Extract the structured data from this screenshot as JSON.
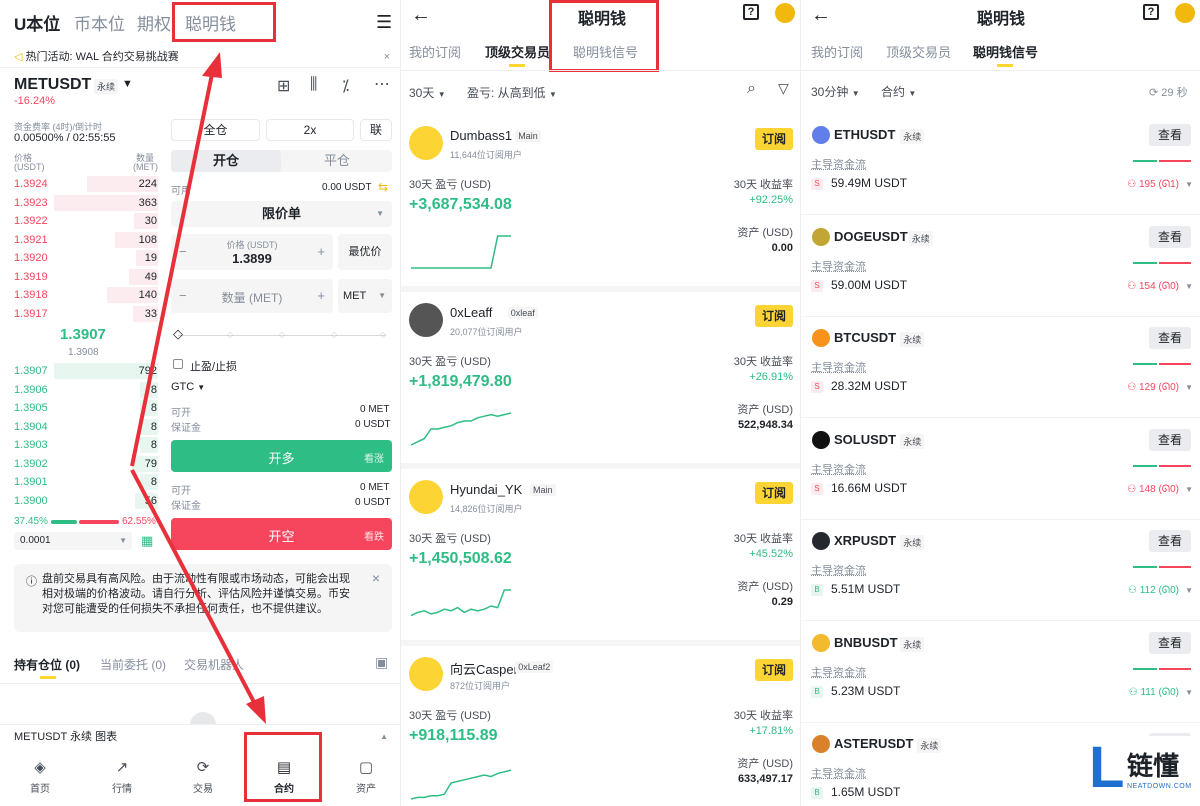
{
  "panel1": {
    "tabs": [
      "U本位",
      "币本位",
      "期权",
      "聪明钱"
    ],
    "menu_icon": "hamburger-icon",
    "banner": "热门活动: WAL 合约交易挑战赛",
    "symbol": "METUSDT",
    "perp": "永续",
    "change": "-16.24%",
    "funding_label": "资金费率 (4时)/倒计时",
    "funding_value": "0.00500% / 02:55:55",
    "ob_price_label": "价格",
    "ob_price_unit": "(USDT)",
    "ob_qty_label": "数量",
    "ob_qty_unit": "(MET)",
    "asks": [
      {
        "p": "1.3924",
        "q": "224"
      },
      {
        "p": "1.3923",
        "q": "363"
      },
      {
        "p": "1.3922",
        "q": "30"
      },
      {
        "p": "1.3921",
        "q": "108"
      },
      {
        "p": "1.3920",
        "q": "19"
      },
      {
        "p": "1.3919",
        "q": "49"
      },
      {
        "p": "1.3918",
        "q": "140"
      },
      {
        "p": "1.3917",
        "q": "33"
      }
    ],
    "last_price": "1.3907",
    "mark_price": "1.3908",
    "bids": [
      {
        "p": "1.3907",
        "q": "792"
      },
      {
        "p": "1.3906",
        "q": "8"
      },
      {
        "p": "1.3905",
        "q": "8"
      },
      {
        "p": "1.3904",
        "q": "8"
      },
      {
        "p": "1.3903",
        "q": "8"
      },
      {
        "p": "1.3902",
        "q": "79"
      },
      {
        "p": "1.3901",
        "q": "8"
      },
      {
        "p": "1.3900",
        "q": "56"
      }
    ],
    "buy_ratio": "37.45%",
    "sell_ratio": "62.55%",
    "tick": "0.0001",
    "margin_mode": "全仓",
    "leverage": "2x",
    "extra": "联",
    "open_tab": "开仓",
    "close_tab": "平仓",
    "avail_label": "可用",
    "avail_value": "0.00 USDT",
    "order_type": "限价单",
    "price_label": "价格 (USDT)",
    "price_value": "1.3899",
    "best_price": "最优价",
    "qty_placeholder": "数量 (MET)",
    "qty_unit": "MET",
    "tpsl": "止盈/止损",
    "tif": "GTC",
    "open_label": "可开",
    "open_value": "0 MET",
    "margin_label": "保证金",
    "margin_value": "0 USDT",
    "buy_btn": "开多",
    "buy_hint": "看涨",
    "sell_btn": "开空",
    "sell_hint": "看跌",
    "warning": "盘前交易具有高风险。由于流动性有限或市场动态，可能会出现相对极端的价格波动。请自行分析、评估风险并谨慎交易。币安对您可能遭受的任何损失不承担任何责任，也不提供建议。",
    "pos_tabs": [
      "持有仓位 (0)",
      "当前委托 (0)",
      "交易机器人"
    ],
    "chart_bar": "METUSDT 永续 图表",
    "nav": [
      "首页",
      "行情",
      "交易",
      "合约",
      "资产"
    ]
  },
  "panel2": {
    "title": "聪明钱",
    "tabs": [
      "我的订阅",
      "顶级交易员",
      "聪明钱信号"
    ],
    "filter1": "30天",
    "filter2": "盈亏: 从高到低",
    "pnl_label": "30天 盈亏 (USD)",
    "roi_label": "30天 收益率",
    "asset_label": "资产 (USD)",
    "sub_btn": "订阅",
    "traders": [
      {
        "name": "Dumbass1",
        "tag": "Main",
        "subs": "11,644位订阅用户",
        "pnl": "+3,687,534.08",
        "roi": "+92.25%",
        "assets": "0.00",
        "spark": [
          0,
          0,
          0,
          0,
          0,
          0,
          0,
          0,
          0,
          0,
          0,
          0,
          0,
          1,
          1,
          1
        ]
      },
      {
        "name": "0xLeaff",
        "tag": "0xleaf",
        "subs": "20,077位订阅用户",
        "pnl": "+1,819,479.80",
        "roi": "+26.91%",
        "assets": "522,948.34",
        "spark": [
          0,
          0.1,
          0.2,
          0.5,
          0.5,
          0.55,
          0.6,
          0.7,
          0.75,
          0.75,
          0.85,
          0.9,
          0.95,
          0.9,
          0.95,
          1
        ]
      },
      {
        "name": "Hyundai_YK",
        "tag": "Main",
        "subs": "14,826位订阅用户",
        "pnl": "+1,450,508.62",
        "roi": "+45.52%",
        "assets": "0.29",
        "spark": [
          0.2,
          0.3,
          0.35,
          0.25,
          0.3,
          0.4,
          0.35,
          0.45,
          0.3,
          0.4,
          0.35,
          0.4,
          0.5,
          0.45,
          1,
          1
        ]
      },
      {
        "name": "向云Casper",
        "tag": "0xLeaf2",
        "subs": "872位订阅用户",
        "pnl": "+918,115.89",
        "roi": "+17.81%",
        "assets": "633,497.17",
        "spark": [
          0,
          0.05,
          0.05,
          0.1,
          0.1,
          0.15,
          0.5,
          0.55,
          0.6,
          0.65,
          0.7,
          0.75,
          0.7,
          0.8,
          0.85,
          0.9
        ]
      }
    ]
  },
  "panel3": {
    "title": "聪明钱",
    "tabs": [
      "我的订阅",
      "顶级交易员",
      "聪明钱信号"
    ],
    "filter1": "30分钟",
    "filter2": "合约",
    "refresh": "29 秒",
    "flow_label": "主导资金流",
    "perp": "永续",
    "view_btn": "查看",
    "signals": [
      {
        "sym": "ETHUSDT",
        "coin": "eth-icon",
        "color": "#627eea",
        "side": "S",
        "flow": "59.49M USDT",
        "users": "195",
        "extra": "1",
        "up": false
      },
      {
        "sym": "DOGEUSDT",
        "coin": "doge-icon",
        "color": "#c2a633",
        "side": "S",
        "flow": "59.00M USDT",
        "users": "154",
        "extra": "0",
        "up": false
      },
      {
        "sym": "BTCUSDT",
        "coin": "btc-icon",
        "color": "#f7931a",
        "side": "S",
        "flow": "28.32M USDT",
        "users": "129",
        "extra": "0",
        "up": false
      },
      {
        "sym": "SOLUSDT",
        "coin": "sol-icon",
        "color": "#111111",
        "side": "S",
        "flow": "16.66M USDT",
        "users": "148",
        "extra": "0",
        "up": false
      },
      {
        "sym": "XRPUSDT",
        "coin": "xrp-icon",
        "color": "#23292f",
        "side": "B",
        "flow": "5.51M USDT",
        "users": "112",
        "extra": "0",
        "up": true
      },
      {
        "sym": "BNBUSDT",
        "coin": "bnb-icon",
        "color": "#f3ba2f",
        "side": "B",
        "flow": "5.23M USDT",
        "users": "111",
        "extra": "0",
        "up": true
      },
      {
        "sym": "ASTERUSDT",
        "coin": "aster-icon",
        "color": "#d9822b",
        "side": "B",
        "flow": "1.65M USDT",
        "users": "",
        "extra": "",
        "up": true
      }
    ]
  },
  "watermark": {
    "text": "链懂",
    "sub": "NEATDOWN.COM",
    "letter": "L"
  },
  "colors": {
    "green": "#2ebd85",
    "red": "#f6465d",
    "yellow": "#fcd535",
    "annotation": "#e8303a"
  }
}
